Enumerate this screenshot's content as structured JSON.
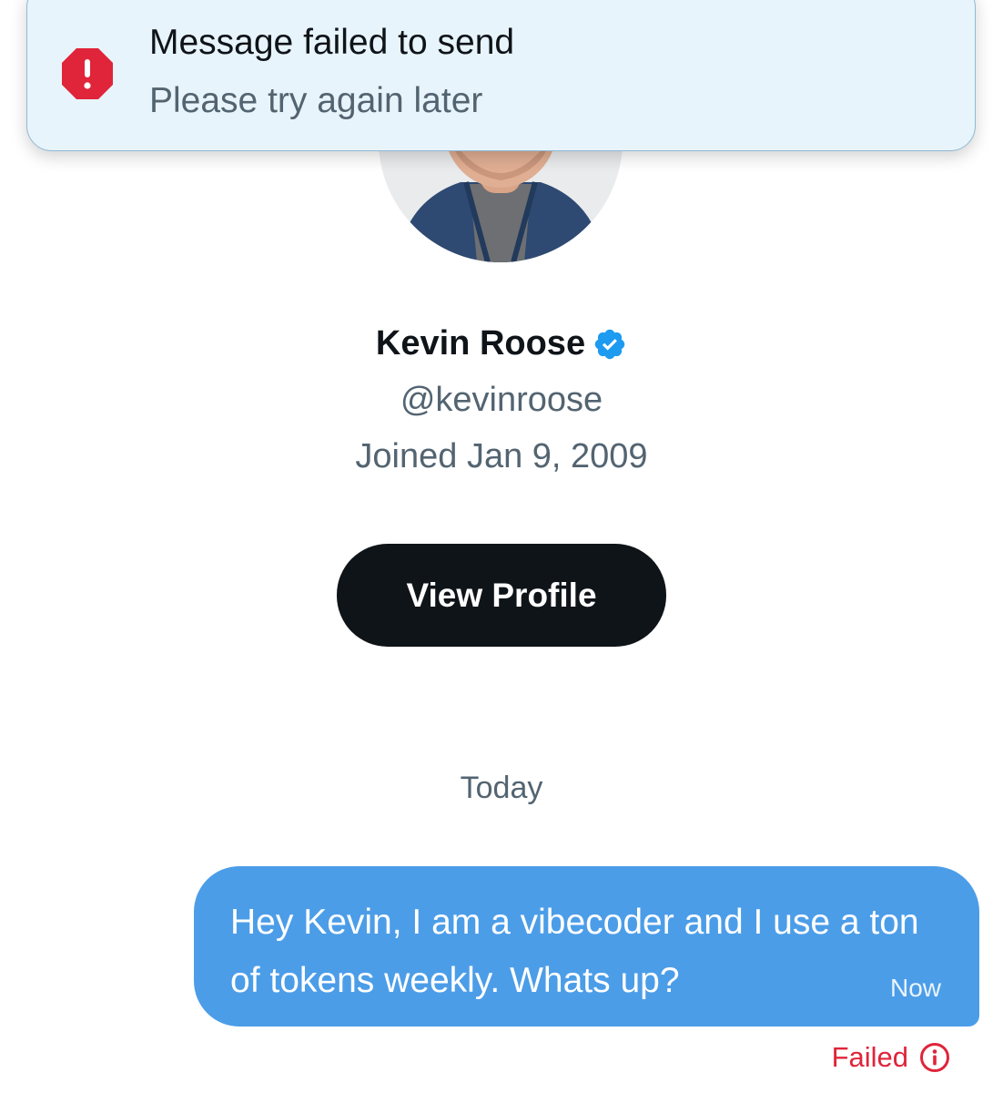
{
  "toast": {
    "title": "Message failed to send",
    "subtitle": "Please try again later",
    "icon": "error-octagon-icon",
    "icon_color": "#e0243a",
    "background_color": "#e8f4fb"
  },
  "profile": {
    "name": "Kevin Roose",
    "verified": true,
    "verified_icon": "verified-badge-icon",
    "verified_color": "#1d9bf0",
    "handle": "@kevinroose",
    "joined": "Joined Jan 9, 2009",
    "view_profile_label": "View Profile"
  },
  "conversation": {
    "date_divider": "Today",
    "messages": [
      {
        "text": "Hey Kevin, I am a vibecoder and I use a ton of tokens weekly. Whats up?",
        "time": "Now",
        "status": "Failed",
        "status_icon": "info-icon",
        "bubble_color": "#4c9de8",
        "status_color": "#e0243a"
      }
    ]
  }
}
